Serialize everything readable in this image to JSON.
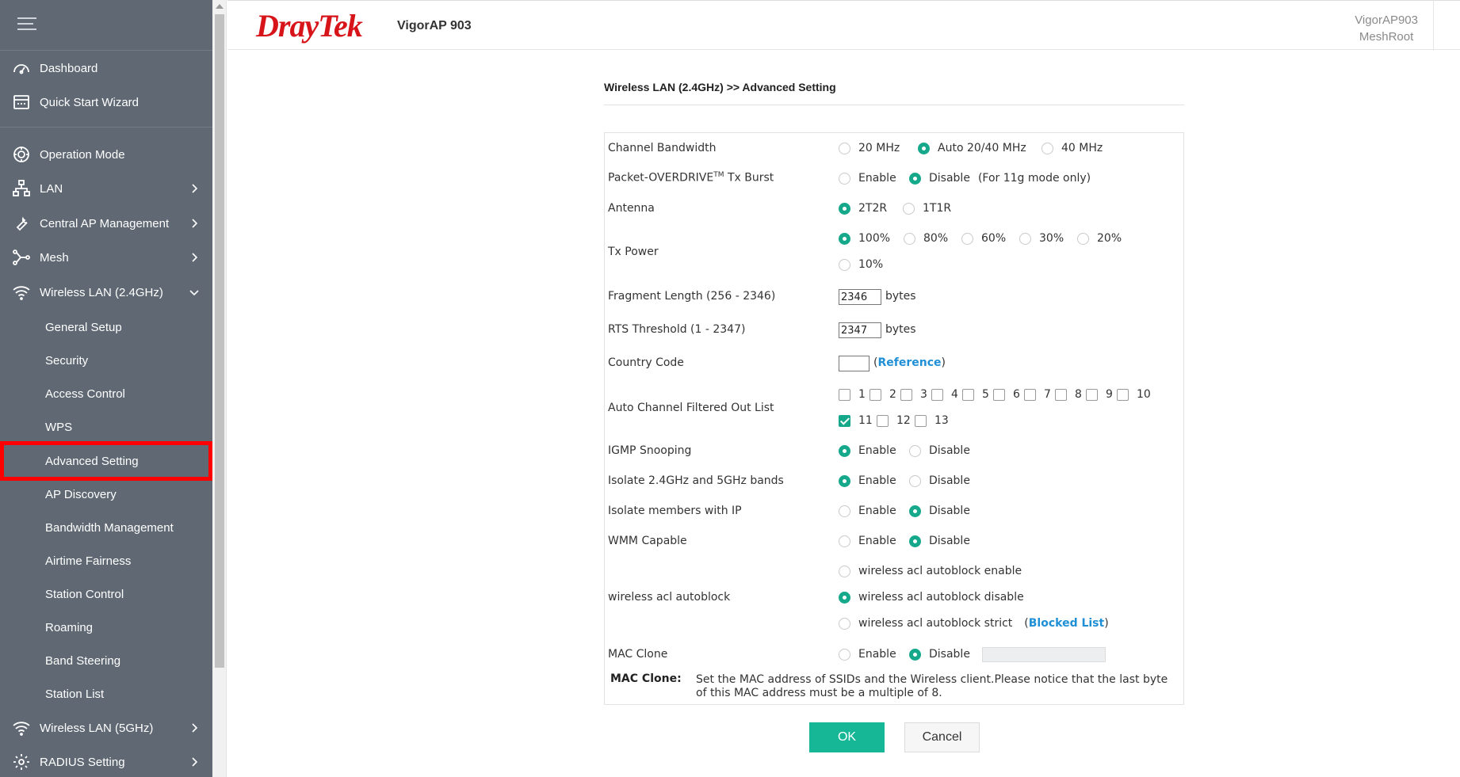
{
  "header": {
    "brand": "DrayTek",
    "model": "VigorAP 903",
    "host_name": "VigorAP903",
    "host_role": "MeshRoot"
  },
  "sidebar": {
    "items": [
      {
        "label": "Dashboard",
        "icon": "dashboard-icon"
      },
      {
        "label": "Quick Start Wizard",
        "icon": "wizard-icon"
      },
      {
        "label": "Operation Mode",
        "icon": "operation-mode-icon"
      },
      {
        "label": "LAN",
        "icon": "lan-icon"
      },
      {
        "label": "Central AP Management",
        "icon": "wrench-icon"
      },
      {
        "label": "Mesh",
        "icon": "mesh-icon"
      },
      {
        "label": "Wireless LAN (2.4GHz)",
        "icon": "wifi-icon"
      },
      {
        "label": "Wireless LAN (5GHz)",
        "icon": "wifi-icon"
      },
      {
        "label": "RADIUS Setting",
        "icon": "gear-icon"
      }
    ],
    "subitems": [
      "General Setup",
      "Security",
      "Access Control",
      "WPS",
      "Advanced Setting",
      "AP Discovery",
      "Bandwidth Management",
      "Airtime Fairness",
      "Station Control",
      "Roaming",
      "Band Steering",
      "Station List"
    ],
    "active_subitem": "Advanced Setting"
  },
  "page": {
    "breadcrumb": "Wireless LAN (2.4GHz) >> Advanced Setting",
    "channel_bandwidth": {
      "label": "Channel Bandwidth",
      "options": [
        "20 MHz",
        "Auto 20/40 MHz",
        "40 MHz"
      ],
      "selected": "Auto 20/40 MHz"
    },
    "packet_overdrive": {
      "label": "Packet-OVERDRIVE",
      "label_sup": "TM",
      "label_suffix": " Tx Burst",
      "options": [
        "Enable",
        "Disable"
      ],
      "selected": "Disable",
      "note": "(For 11g mode only)"
    },
    "antenna": {
      "label": "Antenna",
      "options": [
        "2T2R",
        "1T1R"
      ],
      "selected": "2T2R"
    },
    "tx_power": {
      "label": "Tx Power",
      "options": [
        "100%",
        "80%",
        "60%",
        "30%",
        "20%",
        "10%"
      ],
      "selected": "100%"
    },
    "fragment_length": {
      "label": "Fragment Length (256 - 2346)",
      "value": "2346",
      "unit": "bytes"
    },
    "rts_threshold": {
      "label": "RTS Threshold (1 - 2347)",
      "value": "2347",
      "unit": "bytes"
    },
    "country_code": {
      "label": "Country Code",
      "value": "",
      "link": "Reference",
      "open": "(",
      "close": ")"
    },
    "auto_channel": {
      "label": "Auto Channel Filtered Out List",
      "channels": [
        "1",
        "2",
        "3",
        "4",
        "5",
        "6",
        "7",
        "8",
        "9",
        "10",
        "11",
        "12",
        "13"
      ],
      "checked": [
        "11"
      ]
    },
    "igmp_snooping": {
      "label": "IGMP Snooping",
      "options": [
        "Enable",
        "Disable"
      ],
      "selected": "Enable"
    },
    "isolate_bands": {
      "label": "Isolate 2.4GHz and 5GHz bands",
      "options": [
        "Enable",
        "Disable"
      ],
      "selected": "Enable"
    },
    "isolate_members": {
      "label": "Isolate members with IP",
      "options": [
        "Enable",
        "Disable"
      ],
      "selected": "Disable"
    },
    "wmm_capable": {
      "label": "WMM Capable",
      "options": [
        "Enable",
        "Disable"
      ],
      "selected": "Disable"
    },
    "acl_autoblock": {
      "label": "wireless acl autoblock",
      "options": [
        "wireless acl autoblock enable",
        "wireless acl autoblock disable",
        "wireless acl autoblock strict"
      ],
      "selected": "wireless acl autoblock disable",
      "link": "Blocked List",
      "open": "(",
      "close": ")"
    },
    "mac_clone": {
      "label": "MAC Clone",
      "options": [
        "Enable",
        "Disable"
      ],
      "selected": "Disable",
      "value": ""
    },
    "note": {
      "title": "MAC Clone:",
      "text": "Set the MAC address of SSIDs and the Wireless client.Please notice that the last byte of this MAC address must be a multiple of 8."
    },
    "buttons": {
      "ok": "OK",
      "cancel": "Cancel"
    }
  },
  "colors": {
    "accent": "#16a88a",
    "ok_button": "#16b796",
    "sidebar": "#5f6873",
    "brand_red": "#d7141a",
    "link": "#1f8fd6",
    "highlight": "#ff0000"
  }
}
